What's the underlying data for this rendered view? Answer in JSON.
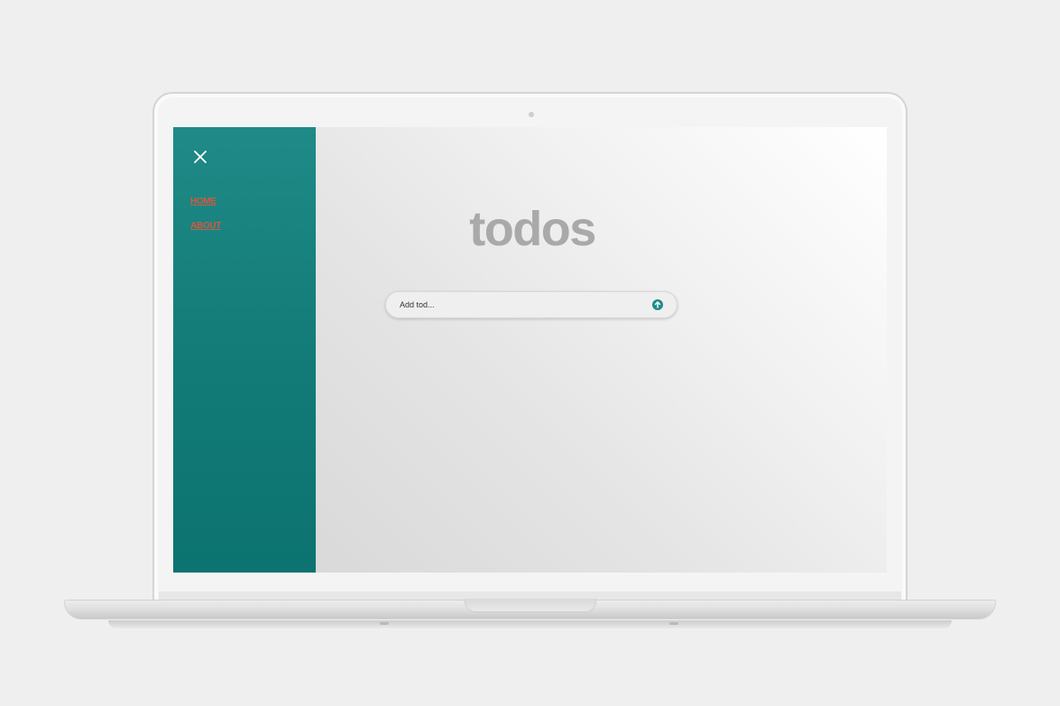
{
  "app": {
    "title": "todos"
  },
  "sidebar": {
    "close_icon": "close-icon",
    "items": [
      {
        "label": "HOME"
      },
      {
        "label": "ABOUT"
      }
    ]
  },
  "todo_form": {
    "placeholder": "Add tod...",
    "value": "",
    "add_icon": "plus-circle-icon"
  },
  "colors": {
    "sidebar": "#1a8582",
    "nav_link": "#d35a3e",
    "title": "#a9a9a9",
    "add_button": "#1e8c88",
    "backdrop": "#efefef"
  }
}
